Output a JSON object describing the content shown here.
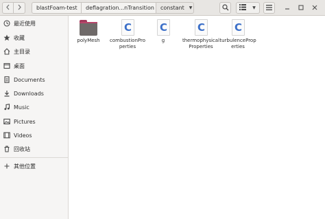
{
  "window": {
    "breadcrumbs": [
      "blastFoam-test",
      "deflagration...nTransition",
      "constant"
    ]
  },
  "toolbar": {
    "back_icon": "chevron-left-icon",
    "forward_icon": "chevron-right-icon",
    "search_icon": "search-icon",
    "view_icon": "list-view-icon",
    "view_options_icon": "chevron-down-icon",
    "menu_icon": "hamburger-menu-icon"
  },
  "sidebar": {
    "items": [
      {
        "label": "最近使用",
        "icon": "clock-icon"
      },
      {
        "label": "收藏",
        "icon": "star-icon"
      },
      {
        "label": "主目录",
        "icon": "home-icon"
      },
      {
        "label": "桌面",
        "icon": "desktop-icon"
      },
      {
        "label": "Documents",
        "icon": "document-icon"
      },
      {
        "label": "Downloads",
        "icon": "download-icon"
      },
      {
        "label": "Music",
        "icon": "music-icon"
      },
      {
        "label": "Pictures",
        "icon": "picture-icon"
      },
      {
        "label": "Videos",
        "icon": "video-icon"
      },
      {
        "label": "回收站",
        "icon": "trash-icon"
      },
      {
        "label": "其他位置",
        "icon": "plus-icon"
      }
    ]
  },
  "files": [
    {
      "name": "polyMesh",
      "type": "folder"
    },
    {
      "name": "combustionProperties",
      "type": "c-file",
      "glyph": "C"
    },
    {
      "name": "g",
      "type": "c-file",
      "glyph": "C"
    },
    {
      "name": "thermophysicalProperties",
      "type": "c-file",
      "glyph": "C"
    },
    {
      "name": "turbulenceProperties",
      "type": "c-file",
      "glyph": "C"
    }
  ],
  "colors": {
    "accent_folder": "#a13a5b",
    "c_glyph": "#3b6fc8"
  }
}
